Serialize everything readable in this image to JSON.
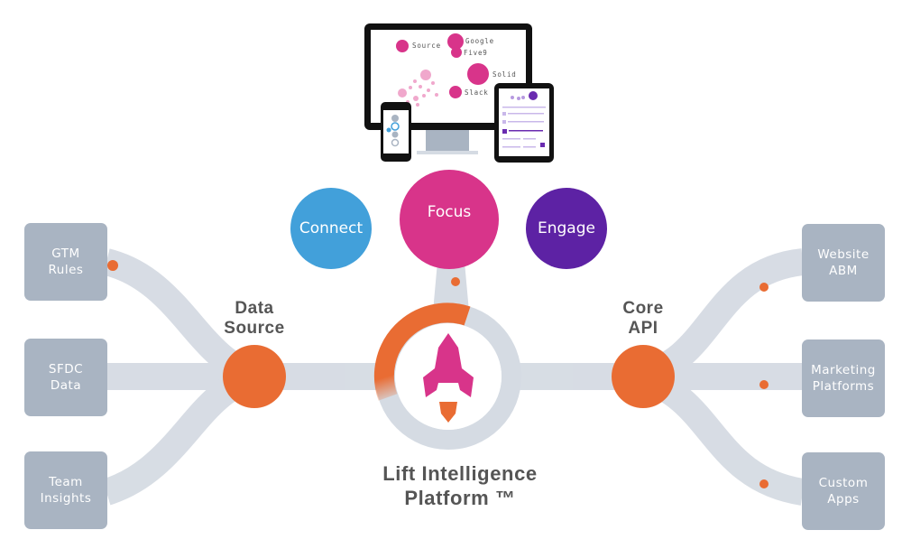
{
  "diagram": {
    "title_line1": "Lift Intelligence",
    "title_line2": "Platform ™",
    "inputs": [
      {
        "line1": "GTM",
        "line2": "Rules"
      },
      {
        "line1": "SFDC",
        "line2": "Data"
      },
      {
        "line1": "Team",
        "line2": "Insights"
      }
    ],
    "outputs": [
      {
        "line1": "Website",
        "line2": "ABM"
      },
      {
        "line1": "Marketing",
        "line2": "Platforms"
      },
      {
        "line1": "Custom",
        "line2": "Apps"
      }
    ],
    "left_hub": {
      "line1": "Data",
      "line2": "Source"
    },
    "right_hub": {
      "line1": "Core",
      "line2": "API"
    },
    "pillars": [
      {
        "label": "Connect",
        "color": "#42a0da"
      },
      {
        "label": "Focus",
        "color": "#d8348a"
      },
      {
        "label": "Engage",
        "color": "#5d22a4"
      }
    ],
    "center_icon": "rocket-icon",
    "monitor_labels": [
      "Source",
      "Google",
      "Five9",
      "Solid",
      "Slack"
    ],
    "colors": {
      "accent_orange": "#e96c33",
      "box_gray": "#a9b4c2",
      "track_gray": "#d5dbe3",
      "text_gray": "#555555"
    }
  }
}
